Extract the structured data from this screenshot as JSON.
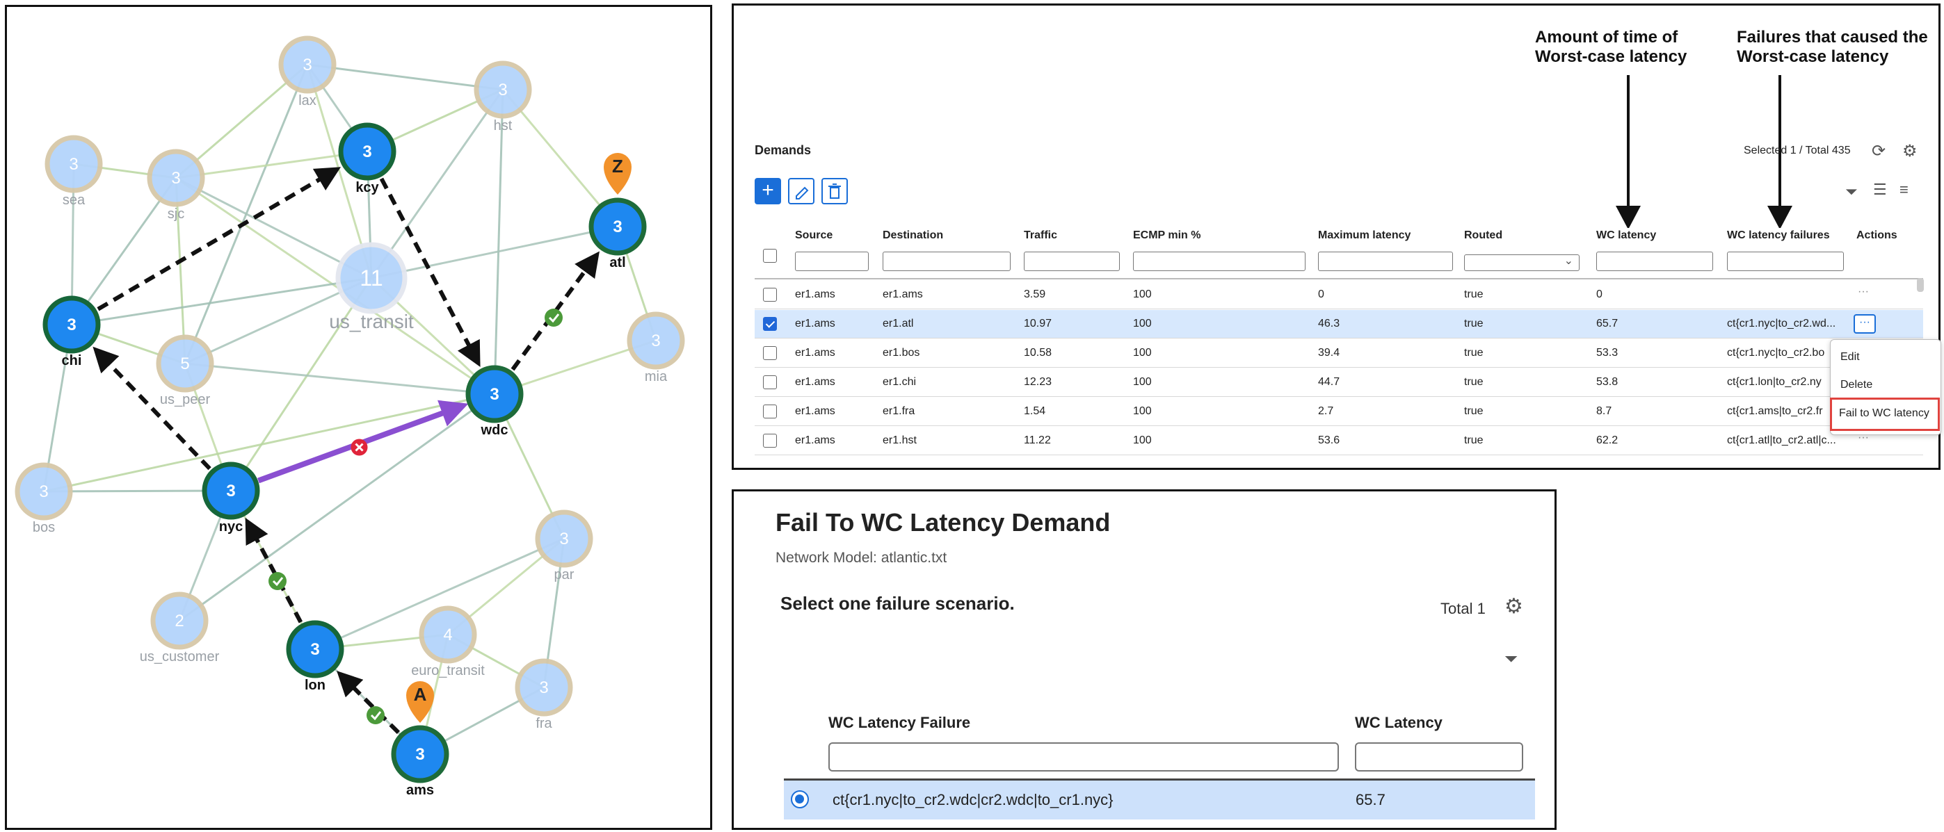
{
  "graph": {
    "nodes": [
      {
        "id": "lax",
        "label": "lax",
        "count": "3",
        "kind": "faded"
      },
      {
        "id": "hst",
        "label": "hst",
        "count": "3",
        "kind": "faded"
      },
      {
        "id": "sea",
        "label": "sea",
        "count": "3",
        "kind": "faded"
      },
      {
        "id": "sjc",
        "label": "sjc",
        "count": "3",
        "kind": "faded"
      },
      {
        "id": "kcy",
        "label": "kcy",
        "count": "3",
        "kind": "path"
      },
      {
        "id": "atl",
        "label": "atl",
        "count": "3",
        "kind": "path"
      },
      {
        "id": "us_transit",
        "label": "us_transit",
        "count": "11",
        "kind": "faded"
      },
      {
        "id": "mia",
        "label": "mia",
        "count": "3",
        "kind": "faded"
      },
      {
        "id": "chi",
        "label": "chi",
        "count": "3",
        "kind": "path"
      },
      {
        "id": "us_peer",
        "label": "us_peer",
        "count": "5",
        "kind": "faded"
      },
      {
        "id": "wdc",
        "label": "wdc",
        "count": "3",
        "kind": "path"
      },
      {
        "id": "bos",
        "label": "bos",
        "count": "3",
        "kind": "faded"
      },
      {
        "id": "nyc",
        "label": "nyc",
        "count": "3",
        "kind": "path"
      },
      {
        "id": "par",
        "label": "par",
        "count": "3",
        "kind": "faded"
      },
      {
        "id": "us_customer",
        "label": "us_customer",
        "count": "2",
        "kind": "faded"
      },
      {
        "id": "euro_transit",
        "label": "euro_transit",
        "count": "4",
        "kind": "faded"
      },
      {
        "id": "lon",
        "label": "lon",
        "count": "3",
        "kind": "path"
      },
      {
        "id": "fra",
        "label": "fra",
        "count": "3",
        "kind": "faded"
      },
      {
        "id": "ams",
        "label": "ams",
        "count": "3",
        "kind": "path"
      }
    ],
    "source_marker": "A",
    "dest_marker": "Z",
    "colors": {
      "node_blue": "#1e88f0",
      "node_faded": "#b4d4fb",
      "failed_link": "#8a4fd1",
      "fail_x": "#e0243a",
      "ok_check": "#4c9a3a",
      "marker": "#f2922b"
    }
  },
  "demands": {
    "title": "Demands",
    "selection_summary": "Selected 1 / Total 435",
    "columns": [
      "Source",
      "Destination",
      "Traffic",
      "ECMP min %",
      "Maximum latency",
      "Routed",
      "WC latency",
      "WC latency failures",
      "Actions"
    ],
    "rows": [
      {
        "source": "er1.ams",
        "destination": "er1.ams",
        "traffic": "3.59",
        "ecmp": "100",
        "max_latency": "0",
        "routed": "true",
        "wc_latency": "0",
        "wc_failures": "",
        "selected": false
      },
      {
        "source": "er1.ams",
        "destination": "er1.atl",
        "traffic": "10.97",
        "ecmp": "100",
        "max_latency": "46.3",
        "routed": "true",
        "wc_latency": "65.7",
        "wc_failures": "ct{cr1.nyc|to_cr2.wd...",
        "selected": true
      },
      {
        "source": "er1.ams",
        "destination": "er1.bos",
        "traffic": "10.58",
        "ecmp": "100",
        "max_latency": "39.4",
        "routed": "true",
        "wc_latency": "53.3",
        "wc_failures": "ct{cr1.nyc|to_cr2.bo",
        "selected": false
      },
      {
        "source": "er1.ams",
        "destination": "er1.chi",
        "traffic": "12.23",
        "ecmp": "100",
        "max_latency": "44.7",
        "routed": "true",
        "wc_latency": "53.8",
        "wc_failures": "ct{cr1.lon|to_cr2.ny",
        "selected": false
      },
      {
        "source": "er1.ams",
        "destination": "er1.fra",
        "traffic": "1.54",
        "ecmp": "100",
        "max_latency": "2.7",
        "routed": "true",
        "wc_latency": "8.7",
        "wc_failures": "ct{cr1.ams|to_cr2.fr",
        "selected": false
      },
      {
        "source": "er1.ams",
        "destination": "er1.hst",
        "traffic": "11.22",
        "ecmp": "100",
        "max_latency": "53.6",
        "routed": "true",
        "wc_latency": "62.2",
        "wc_failures": "ct{cr1.atl|to_cr2.atl|c...",
        "selected": false
      }
    ],
    "row_action": "···",
    "context_menu": [
      "Edit",
      "Delete",
      "Fail to WC latency"
    ],
    "annotation_wc_time": "Amount of time of\nWorst-case latency",
    "annotation_wc_failures": "Failures that caused the\nWorst-case latency",
    "highlight_color": "#e0433f"
  },
  "fail_dialog": {
    "title": "Fail To WC Latency Demand",
    "subtitle": "Network Model: atlantic.txt",
    "prompt": "Select one failure scenario.",
    "total": "Total 1",
    "columns": [
      "WC Latency Failure",
      "WC Latency"
    ],
    "rows": [
      {
        "failure": "ct{cr1.nyc|to_cr2.wdc|cr2.wdc|to_cr1.nyc}",
        "latency": "65.7",
        "selected": true
      }
    ]
  }
}
